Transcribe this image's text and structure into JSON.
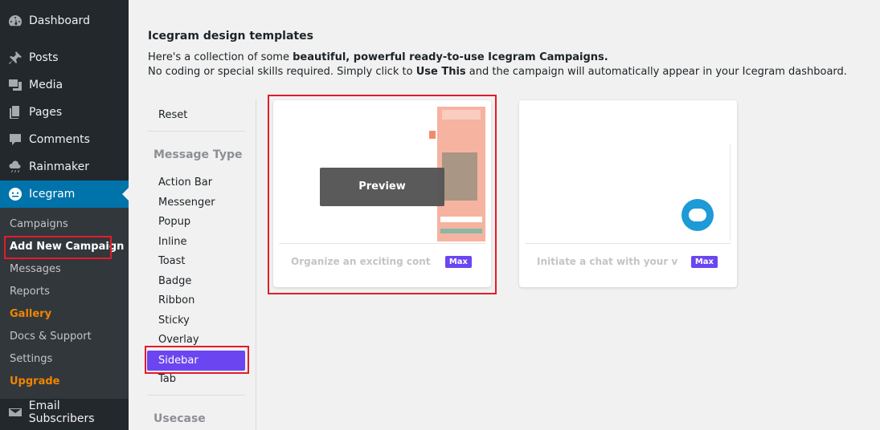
{
  "sidebar": {
    "menu": [
      {
        "label": "Dashboard",
        "icon": "dashboard-icon"
      },
      {
        "label": "Posts",
        "icon": "pin-icon"
      },
      {
        "label": "Media",
        "icon": "media-icon"
      },
      {
        "label": "Pages",
        "icon": "pages-icon"
      },
      {
        "label": "Comments",
        "icon": "comment-icon"
      },
      {
        "label": "Rainmaker",
        "icon": "cloud-icon"
      },
      {
        "label": "Icegram",
        "icon": "icegram-icon"
      },
      {
        "label": "Email Subscribers",
        "icon": "envelope-icon"
      }
    ],
    "submenu": [
      "Campaigns",
      "Add New Campaign",
      "Messages",
      "Reports",
      "Gallery",
      "Docs & Support",
      "Settings",
      "Upgrade"
    ]
  },
  "main": {
    "heading": "Icegram design templates",
    "intro_1_pre": "Here's a collection of some ",
    "intro_1_bold": "beautiful, powerful ready-to-use Icegram Campaigns.",
    "intro_2_pre": "No coding or special skills required. Simply click to ",
    "intro_2_bold": "Use This",
    "intro_2_post": " and the campaign will automatically appear in your Icegram dashboard."
  },
  "filters": {
    "reset": "Reset",
    "message_type_heading": "Message Type",
    "types": [
      "Action Bar",
      "Messenger",
      "Popup",
      "Inline",
      "Toast",
      "Badge",
      "Ribbon",
      "Sticky",
      "Overlay",
      "Sidebar",
      "Tab"
    ],
    "selected": "Sidebar",
    "usecase_heading": "Usecase"
  },
  "cards": [
    {
      "title": "Organize an exciting cont...",
      "badge": "Max",
      "preview_label": "Preview"
    },
    {
      "title": "Initiate a chat with your v...",
      "badge": "Max"
    }
  ],
  "colors": {
    "sidebar_bg": "#23282d",
    "submenu_bg": "#32373c",
    "active_blue": "#0073aa",
    "accent_purple": "#6b46f0",
    "highlight_red": "#e11d2b",
    "upgrade_orange": "#f18500"
  }
}
